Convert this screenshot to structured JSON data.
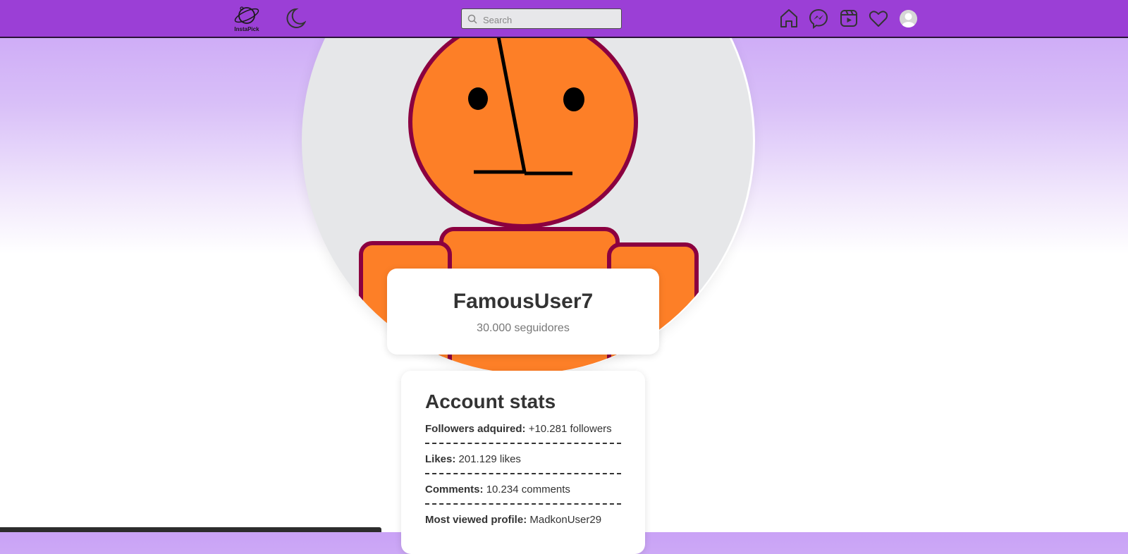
{
  "app": {
    "logo_text": "InstaPick"
  },
  "header": {
    "search_placeholder": "Search",
    "nav_icons": [
      "home-icon",
      "messenger-icon",
      "reels-icon",
      "heart-icon",
      "avatar"
    ],
    "accent_color": "#9b3fd6"
  },
  "profile": {
    "username": "FamousUser7",
    "followers_text": "30.000 seguidores"
  },
  "stats": {
    "title": "Account stats",
    "rows": [
      {
        "label": "Followers adquired:",
        "value": "+10.281 followers"
      },
      {
        "label": "Likes:",
        "value": "201.129 likes"
      },
      {
        "label": "Comments:",
        "value": "10.234 comments"
      },
      {
        "label": "Most viewed profile:",
        "value": "MadkonUser29"
      }
    ]
  },
  "colors": {
    "figure_fill": "#fd7f27",
    "figure_outline": "#8b0040",
    "circle_bg": "#e6e7e9"
  }
}
